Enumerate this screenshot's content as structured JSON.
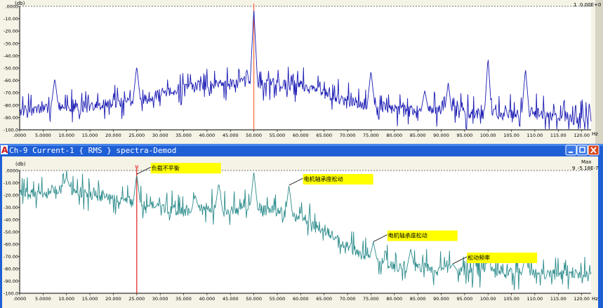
{
  "window": {
    "title": "Ch-9 Current-1 { RMS } spectra-Demod",
    "app_letter": "A",
    "buttons": [
      "minimize",
      "maximize",
      "close"
    ]
  },
  "top_panel": {
    "unit_label": "(db)",
    "readout_index": "1",
    "readout_value": "0.00E+0",
    "x_unit": "Hz"
  },
  "bottom_panel": {
    "unit_label": "(db)",
    "max_label": "Max",
    "readout_index": "9",
    "readout_value": "-5.18E-7",
    "x_unit": "Hz",
    "cursor_marker": "M",
    "annotations": [
      {
        "text": "负载不平衡",
        "x": 25.0,
        "y": -3
      },
      {
        "text": "电机轴承座松动",
        "x": 57.5,
        "y": -12
      },
      {
        "text": "电机轴承座松动",
        "x": 75.5,
        "y": -58
      },
      {
        "text": "松动频率",
        "x": 92.5,
        "y": -76
      }
    ]
  },
  "chart_data": [
    {
      "type": "line",
      "title": "",
      "xlabel": "Hz",
      "ylabel": "(db)",
      "xlim": [
        0,
        122
      ],
      "ylim": [
        -100,
        0
      ],
      "x_tick_labels": [
        ".0000",
        "5.0000",
        "10.000",
        "15.000",
        "20.000",
        "25.000",
        "30.000",
        "35.000",
        "40.000",
        "45.000",
        "50.000",
        "55.000",
        "60.000",
        "65.000",
        "70.000",
        "75.000",
        "80.000",
        "85.000",
        "90.000",
        "95.000",
        "100.00",
        "105.00",
        "110.00",
        "115.00",
        "120.00"
      ],
      "y_tick_labels": [
        ".0000",
        "-10.00",
        "-20.00",
        "-30.00",
        "-40.00",
        "-50.00",
        "-60.00",
        "-70.00",
        "-80.00",
        "-90.00",
        "-100.0"
      ],
      "series": [
        {
          "color": "#1a1ab4",
          "noise_floor": [
            [
              0,
              -85
            ],
            [
              8,
              -82
            ],
            [
              15,
              -80
            ],
            [
              25,
              -76
            ],
            [
              35,
              -66
            ],
            [
              45,
              -63
            ],
            [
              50,
              -62
            ],
            [
              55,
              -63
            ],
            [
              60,
              -64
            ],
            [
              65,
              -70
            ],
            [
              70,
              -77
            ],
            [
              80,
              -83
            ],
            [
              90,
              -85
            ],
            [
              100,
              -88
            ],
            [
              110,
              -86
            ],
            [
              122,
              -92
            ]
          ],
          "peaks": [
            {
              "x": 7.5,
              "y": -58
            },
            {
              "x": 25.0,
              "y": -48
            },
            {
              "x": 50.0,
              "y": -2
            },
            {
              "x": 75.0,
              "y": -52
            },
            {
              "x": 86.5,
              "y": -68
            },
            {
              "x": 91.5,
              "y": -62
            },
            {
              "x": 100.0,
              "y": -41
            },
            {
              "x": 108.0,
              "y": -50
            }
          ]
        }
      ],
      "cursor": {
        "x": 50.0,
        "color": "#ff6a3a"
      }
    },
    {
      "type": "line",
      "title": "",
      "xlabel": "Hz",
      "ylabel": "(db)",
      "xlim": [
        0,
        122
      ],
      "ylim": [
        -100,
        0
      ],
      "x_tick_labels": [
        ".0000",
        "5.0000",
        "10.000",
        "15.000",
        "20.000",
        "25.000",
        "30.000",
        "35.000",
        "40.000",
        "45.000",
        "50.000",
        "55.000",
        "60.000",
        "65.000",
        "70.000",
        "75.000",
        "80.000",
        "85.000",
        "90.000",
        "95.000",
        "100.00",
        "105.00",
        "110.00",
        "115.00",
        "120.00"
      ],
      "y_tick_labels": [
        ".0000",
        "-10.00",
        "-20.00",
        "-30.00",
        "-40.00",
        "-50.00",
        "-60.00",
        "-70.00",
        "-80.00",
        "-90.00",
        "-100.0"
      ],
      "series": [
        {
          "color": "#2e8c8c",
          "noise_floor": [
            [
              0,
              -18
            ],
            [
              5,
              -20
            ],
            [
              10,
              -14
            ],
            [
              15,
              -20
            ],
            [
              20,
              -22
            ],
            [
              25,
              -27
            ],
            [
              30,
              -30
            ],
            [
              35,
              -34
            ],
            [
              40,
              -30
            ],
            [
              45,
              -33
            ],
            [
              50,
              -30
            ],
            [
              55,
              -35
            ],
            [
              60,
              -38
            ],
            [
              65,
              -48
            ],
            [
              70,
              -62
            ],
            [
              75,
              -72
            ],
            [
              80,
              -78
            ],
            [
              90,
              -80
            ],
            [
              100,
              -83
            ],
            [
              110,
              -84
            ],
            [
              122,
              -86
            ]
          ],
          "peaks": [
            {
              "x": 10.0,
              "y": -5
            },
            {
              "x": 25.0,
              "y": -3
            },
            {
              "x": 37.5,
              "y": -20
            },
            {
              "x": 42.5,
              "y": -10
            },
            {
              "x": 50.0,
              "y": -1
            },
            {
              "x": 57.5,
              "y": -12
            },
            {
              "x": 75.5,
              "y": -58
            },
            {
              "x": 83.5,
              "y": -64
            },
            {
              "x": 92.5,
              "y": -76
            },
            {
              "x": 100.0,
              "y": -70
            },
            {
              "x": 108.0,
              "y": -68
            }
          ]
        }
      ],
      "cursor": {
        "x": 25.0,
        "color": "#e02020"
      }
    }
  ]
}
